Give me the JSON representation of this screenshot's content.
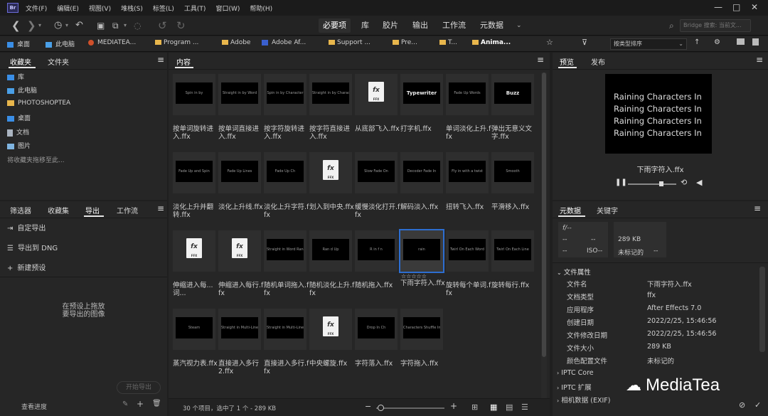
{
  "menubar": {
    "logo": "Br",
    "items": [
      "文件(F)",
      "编辑(E)",
      "视图(V)",
      "堆栈(S)",
      "标签(L)",
      "工具(T)",
      "窗口(W)",
      "帮助(H)"
    ]
  },
  "toolbar": {
    "workspaces": [
      "必要项",
      "库",
      "胶片",
      "输出",
      "工作流",
      "元数据"
    ],
    "search_placeholder": "Bridge 搜索: 当前文..."
  },
  "pathbar": {
    "crumbs": [
      "桌面",
      "此电脑",
      "MEDIATEA...",
      "Program ...",
      "Adobe",
      "Adobe Af...",
      "Support ...",
      "Pre...",
      "T...",
      "Anima..."
    ],
    "sort": "按类型排序"
  },
  "left_top": {
    "tabs": [
      "收藏夹",
      "文件夹"
    ],
    "items": [
      "库",
      "此电脑",
      "PHOTOSHOPTEA",
      "桌面",
      "文档",
      "图片"
    ],
    "hint": "将收藏夹拖移至此..."
  },
  "left_bottom": {
    "tabs": [
      "筛选器",
      "收藏集",
      "导出",
      "工作流"
    ],
    "items": [
      "自定导出",
      "导出到 DNG",
      "新建预设"
    ],
    "drop_hint": [
      "在预设上拖放",
      "要导出的图像"
    ],
    "start_button": "开始导出",
    "footer": "查看进度"
  },
  "content": {
    "tab": "内容",
    "status": "30 个项目，选中了 1 个 - 289 KB",
    "rows": [
      [
        {
          "thumb": "Spin in by",
          "caption": "按单词旋转进入.ffx"
        },
        {
          "thumb": "Straight in by Word",
          "caption": "按单词直接进入.ffx"
        },
        {
          "thumb": "Spin in by Character",
          "caption": "按字符旋转进入.ffx"
        },
        {
          "thumb": "Straight in by Character",
          "caption": "按字符直接进入.ffx"
        },
        {
          "thumb": "ffx",
          "caption": "从底部飞入.ffx"
        },
        {
          "thumb": "Typewriter",
          "caption": "打字机.ffx"
        },
        {
          "thumb": "Fade Up Words",
          "caption": "单词淡化上升.ffx"
        },
        {
          "thumb": "Buzz",
          "caption": "弹出无意义文字.ffx"
        }
      ],
      [
        {
          "thumb": "Fade Up and Spin",
          "caption": "淡化上升并翻转.ffx"
        },
        {
          "thumb": "Fade Up Lines",
          "caption": "淡化上升线.ffx"
        },
        {
          "thumb": "Fade Up Ch",
          "caption": "淡化上升字符.ffx"
        },
        {
          "thumb": "ffx",
          "caption": "划入到中央.ffx"
        },
        {
          "thumb": "Slow Fade On",
          "caption": "缓慢淡化打开.ffx"
        },
        {
          "thumb": "Decoder Fade In",
          "caption": "解码淡入.ffx"
        },
        {
          "thumb": "Fly in with a twist",
          "caption": "扭转飞入.ffx"
        },
        {
          "thumb": "Smooth",
          "caption": "平滑移入.ffx"
        }
      ],
      [
        {
          "thumb": "ffx",
          "caption": "伸缩进入每...词..."
        },
        {
          "thumb": "ffx",
          "caption": "伸缩进入每行.ffx"
        },
        {
          "thumb": "Straight in Word Random",
          "caption": "随机单词拖入.ffx"
        },
        {
          "thumb": "Ran d Up",
          "caption": "随机淡化上升.ffx"
        },
        {
          "thumb": "R in f n",
          "caption": "随机拖入.ffx"
        },
        {
          "thumb": "rain",
          "caption": "下雨字符入.ffx",
          "selected": true,
          "rating": "☆☆☆☆☆"
        },
        {
          "thumb": "Twirl On Each Word",
          "caption": "旋转每个单词.ffx"
        },
        {
          "thumb": "Twirl On Each Line",
          "caption": "旋转每行.ffx"
        }
      ],
      [
        {
          "thumb": "Steam",
          "caption": "蒸汽视力表.ffx"
        },
        {
          "thumb": "Straight in Multi-Line",
          "caption": "直接进入多行 2.ffx"
        },
        {
          "thumb": "Straight in Multi-Line",
          "caption": "直接进入多行.ffx"
        },
        {
          "thumb": "ffx",
          "caption": "中央螺旋.ffx"
        },
        {
          "thumb": "Drop In Ch",
          "caption": "字符落入.ffx"
        },
        {
          "thumb": "Characters Shuffle In",
          "caption": "字符拖入.ffx"
        }
      ]
    ]
  },
  "preview": {
    "tabs": [
      "预览",
      "发布"
    ],
    "image_lines": [
      "Raining Characters In",
      "Raining Characters In",
      "Raining Characters In",
      "Raining Characters In"
    ],
    "filename": "下雨字符入.ffx"
  },
  "metadata": {
    "tabs": [
      "元数据",
      "关键字"
    ],
    "box_left": [
      "f/--",
      "--",
      "--",
      "--",
      "ISO--"
    ],
    "box_right": [
      "289 KB",
      "未标记的",
      "--"
    ],
    "section": "文件属性",
    "rows": [
      {
        "k": "文件名",
        "v": "下雨字符入.ffx"
      },
      {
        "k": "文档类型",
        "v": "ffx"
      },
      {
        "k": "应用程序",
        "v": "After Effects 7.0"
      },
      {
        "k": "创建日期",
        "v": "2022/2/25, 15:46:56"
      },
      {
        "k": "文件修改日期",
        "v": "2022/2/25, 15:46:56"
      },
      {
        "k": "文件大小",
        "v": "289 KB"
      },
      {
        "k": "颜色配置文件",
        "v": "未标记的"
      }
    ],
    "sections_collapsed": [
      "IPTC Core",
      "IPTC 扩展",
      "相机数据 (EXIF)"
    ]
  },
  "watermark": "MediaTea",
  "colors": {
    "accent": "#2d6ed1",
    "folder": "#e8b64c",
    "bg": "#1f1f1f",
    "panel": "#262626"
  }
}
